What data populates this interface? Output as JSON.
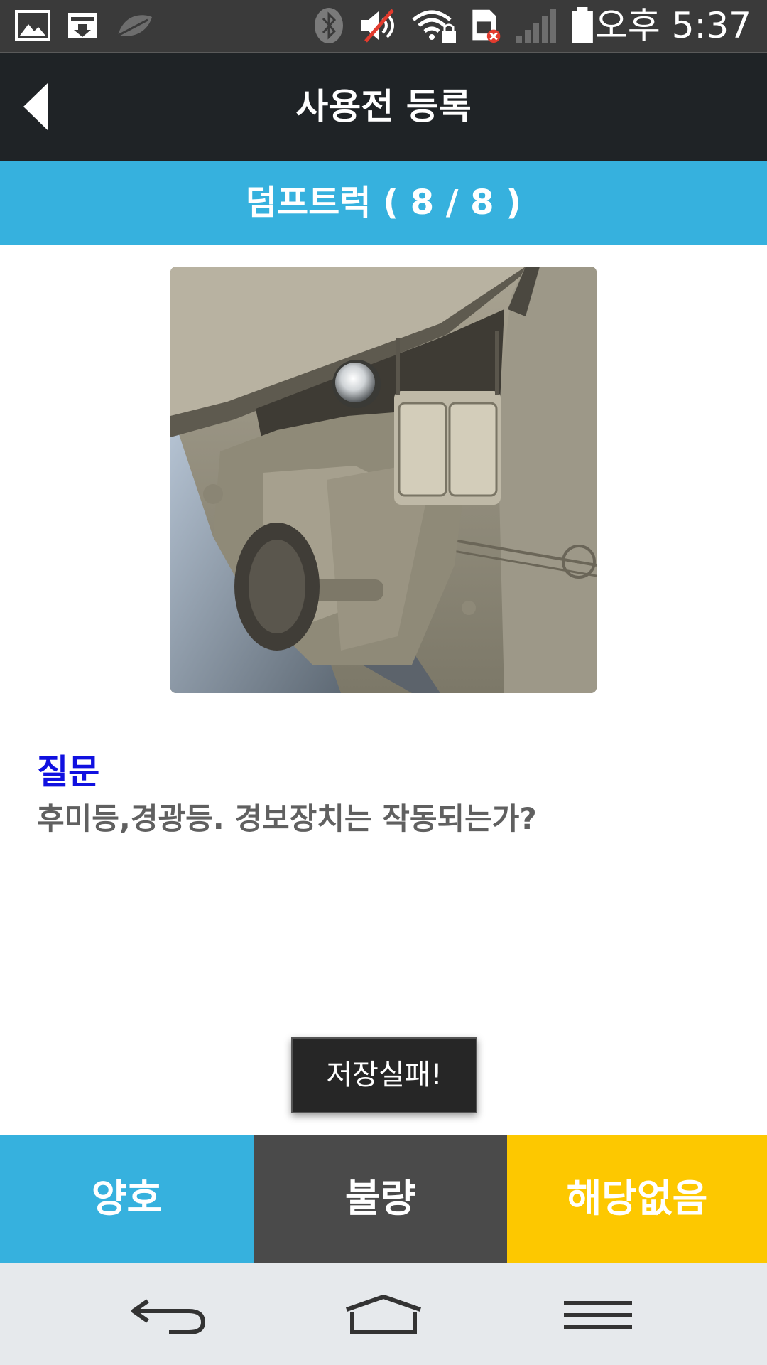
{
  "status_bar": {
    "time": "오후 5:37",
    "icons": [
      "gallery-icon",
      "download-icon",
      "leaf-icon",
      "bluetooth-icon",
      "mute-icon",
      "wifi-lock-icon",
      "sim-error-icon",
      "signal-icon",
      "battery-icon"
    ]
  },
  "header": {
    "title": "사용전 등록"
  },
  "category": {
    "label": "덤프트럭 ( 8 / 8 )"
  },
  "question": {
    "label": "질문",
    "text": "후미등,경광등. 경보장치는 작동되는가?"
  },
  "toast": {
    "message": "저장실패!"
  },
  "answers": {
    "good": "양호",
    "bad": "불량",
    "not_applicable": "해당없음"
  },
  "colors": {
    "accent_blue": "#36b1de",
    "dark_button": "#4a4a4a",
    "yellow_button": "#fdc800",
    "question_label": "#1010e0",
    "title_bar": "#1f2326"
  }
}
